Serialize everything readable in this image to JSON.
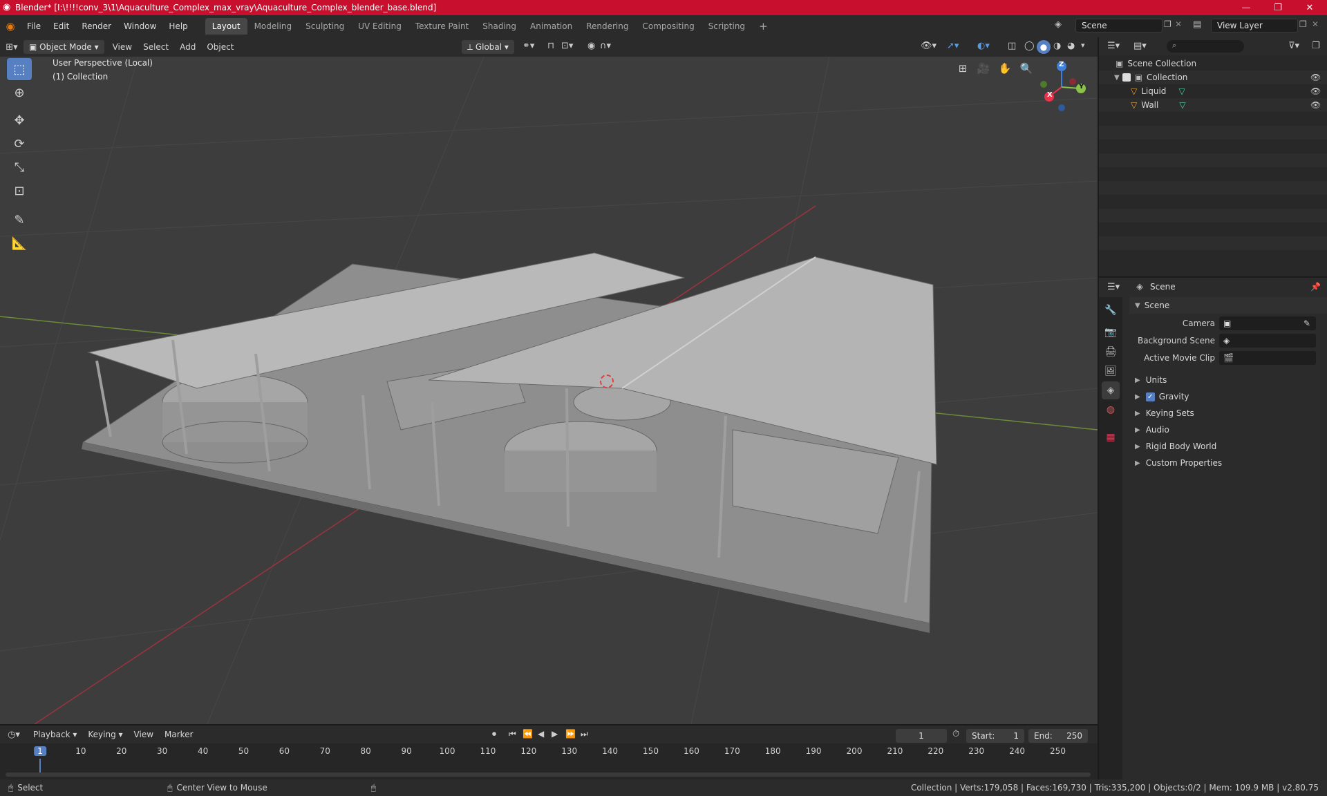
{
  "window": {
    "title": "Blender* [I:\\!!!!conv_3\\1\\Aquaculture_Complex_max_vray\\Aquaculture_Complex_blender_base.blend]",
    "minimize": "—",
    "maximize": "❐",
    "close": "✕"
  },
  "menu": [
    "File",
    "Edit",
    "Render",
    "Window",
    "Help"
  ],
  "workspaces": {
    "tabs": [
      "Layout",
      "Modeling",
      "Sculpting",
      "UV Editing",
      "Texture Paint",
      "Shading",
      "Animation",
      "Rendering",
      "Compositing",
      "Scripting"
    ],
    "add": "+"
  },
  "scene_field": "Scene",
  "view_layer_field": "View Layer",
  "viewport_header": {
    "mode": "Object Mode",
    "menus": [
      "View",
      "Select",
      "Add",
      "Object"
    ],
    "transform_orientation": "Global"
  },
  "viewport": {
    "overlay_line1": "User Perspective (Local)",
    "overlay_line2": "(1) Collection",
    "gizmo": {
      "z": "Z",
      "y": "Y",
      "x": "X"
    }
  },
  "outliner": {
    "root": "Scene Collection",
    "collection": "Collection",
    "objects": [
      "Liquid",
      "Wall"
    ]
  },
  "properties": {
    "context": "Scene",
    "panel_title": "Scene",
    "camera_label": "Camera",
    "background_scene_label": "Background Scene",
    "active_movie_clip_label": "Active Movie Clip",
    "sections": [
      "Units",
      "Gravity",
      "Keying Sets",
      "Audio",
      "Rigid Body World",
      "Custom Properties"
    ]
  },
  "timeline": {
    "menus": [
      "Playback",
      "Keying",
      "View",
      "Marker"
    ],
    "current_frame": "1",
    "start_label": "Start:",
    "start": "1",
    "end_label": "End:",
    "end": "250",
    "ticks": [
      "1",
      "10",
      "20",
      "30",
      "40",
      "50",
      "60",
      "70",
      "80",
      "90",
      "100",
      "110",
      "120",
      "130",
      "140",
      "150",
      "160",
      "170",
      "180",
      "190",
      "200",
      "210",
      "220",
      "230",
      "240",
      "250"
    ]
  },
  "statusbar": {
    "select": "Select",
    "center_view": "Center View to Mouse",
    "stats": "Collection | Verts:179,058 | Faces:169,730 | Tris:335,200 | Objects:0/2 | Mem: 109.9 MB | v2.80.75"
  },
  "colors": {
    "titlebar": "#c8102e",
    "accent": "#5680c2",
    "axis_x": "#e8334a",
    "axis_y": "#8bc34a",
    "axis_z": "#3f7fd9"
  }
}
